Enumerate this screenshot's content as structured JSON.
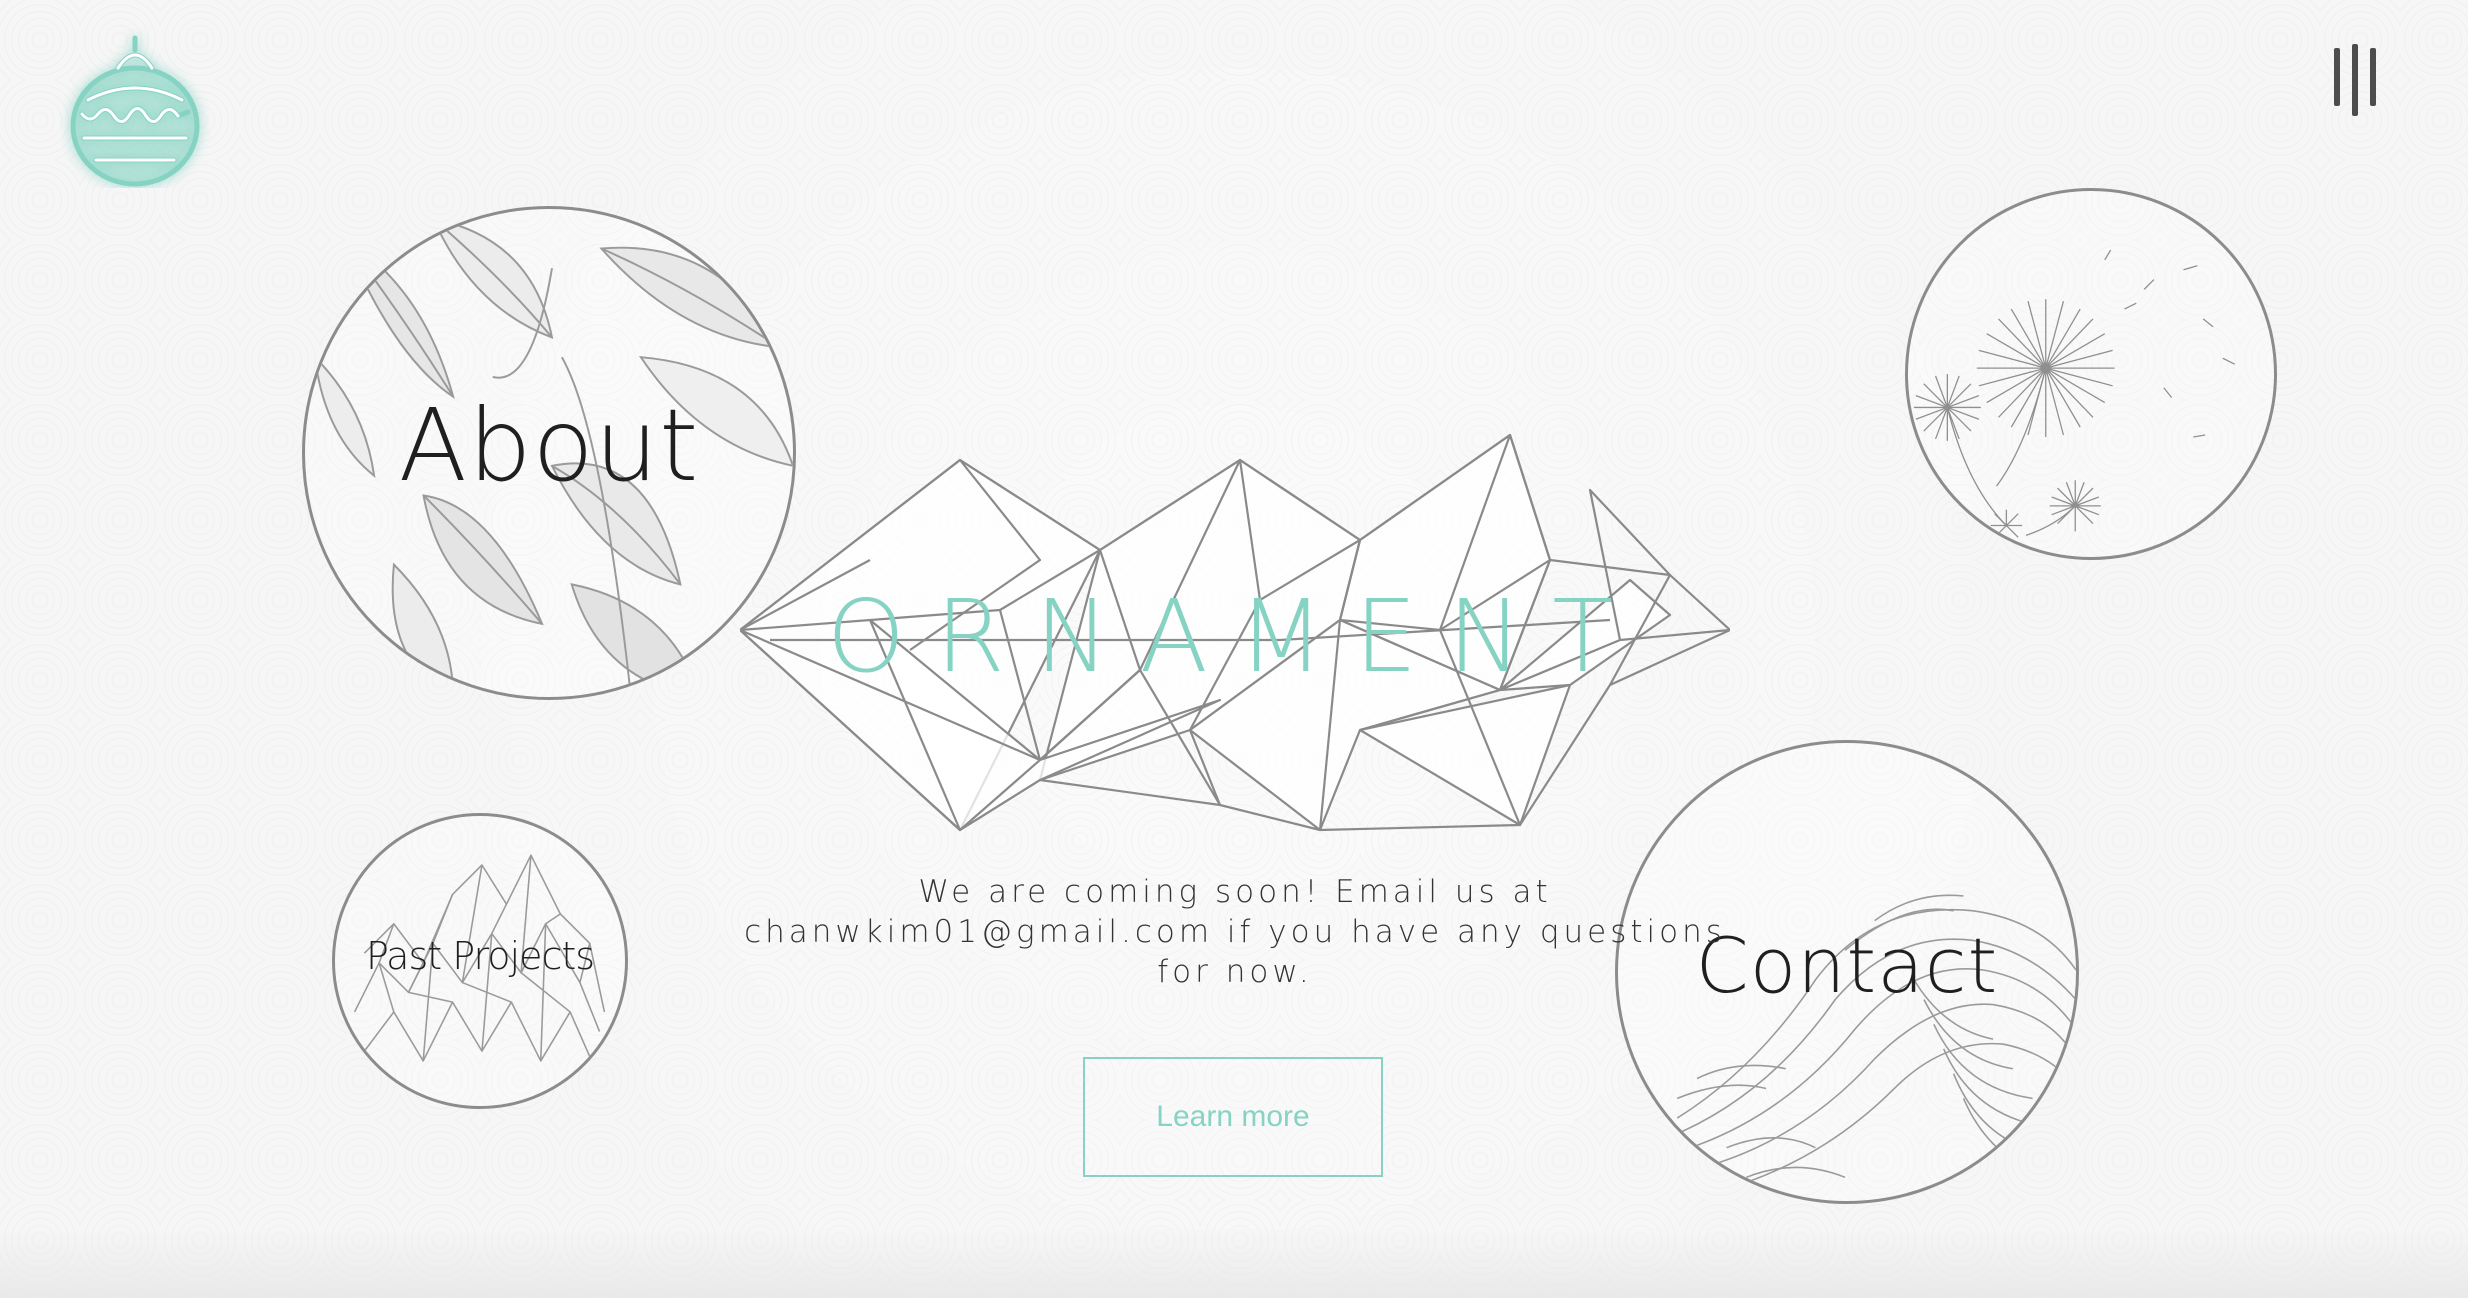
{
  "logo": {
    "icon": "cake-ornament-icon",
    "color": "#86d3c4"
  },
  "menu": {
    "icon": "menu-bars-icon"
  },
  "circles": {
    "about": {
      "label": "About",
      "art": "leaves-illustration"
    },
    "past_projects": {
      "label": "Past Projects",
      "art": "crystal-peaks-illustration"
    },
    "dandelion": {
      "art": "dandelion-illustration"
    },
    "contact": {
      "label": "Contact",
      "art": "wave-illustration"
    }
  },
  "hero": {
    "brand": "ORNAMENT",
    "tagline_line1": "We are coming soon! Email us at",
    "email": "chanwkim01@gmail.com",
    "tagline_line2_rest": " if you have any questions",
    "tagline_line3": "for now.",
    "button_label": "Learn more"
  },
  "colors": {
    "accent": "#86d3c4",
    "background": "#f6f6f6",
    "text": "#333333",
    "outline": "#8c8c8c"
  }
}
